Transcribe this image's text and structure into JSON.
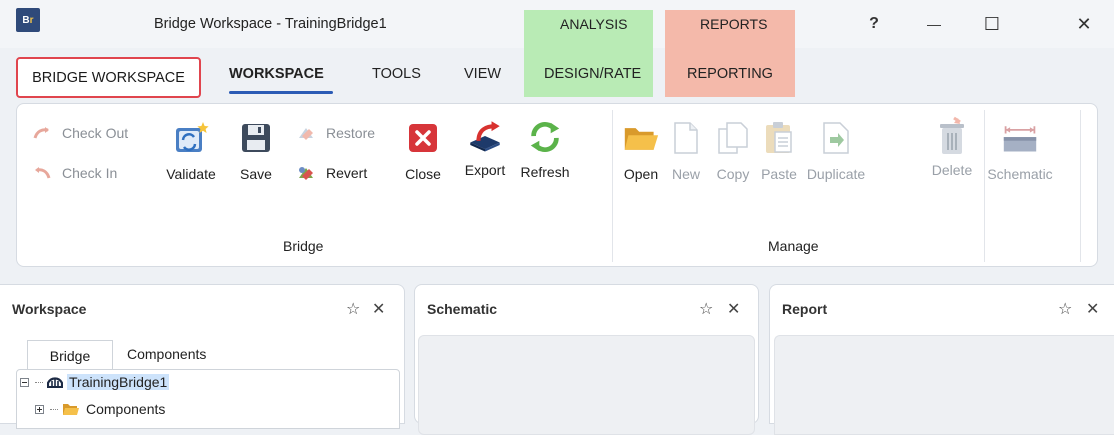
{
  "window": {
    "title": "Bridge Workspace - TrainingBridge1",
    "app_icon": "Br",
    "help": "?",
    "minimize": "—",
    "maximize": "☐",
    "close": "✕"
  },
  "context_tabs": {
    "analysis": {
      "header": "ANALYSIS",
      "tab": "DESIGN/RATE",
      "color": "#b9ebb5"
    },
    "reports": {
      "header": "REPORTS",
      "tab": "REPORTING",
      "color": "#f4b9aa"
    }
  },
  "tabs": {
    "bridge_workspace": "BRIDGE WORKSPACE",
    "workspace": "WORKSPACE",
    "tools": "TOOLS",
    "view": "VIEW"
  },
  "ribbon": {
    "bridge_group": {
      "label": "Bridge",
      "check_out": "Check Out",
      "check_in": "Check In",
      "validate": "Validate",
      "save": "Save",
      "restore": "Restore",
      "revert": "Revert",
      "close": "Close",
      "export": "Export",
      "refresh": "Refresh"
    },
    "manage_group": {
      "label": "Manage",
      "open": "Open",
      "new": "New",
      "copy": "Copy",
      "paste": "Paste",
      "duplicate": "Duplicate",
      "delete": "Delete",
      "schematic": "Schematic"
    }
  },
  "panes": {
    "workspace": {
      "title": "Workspace",
      "tabs": [
        "Bridge",
        "Components"
      ],
      "tree": [
        {
          "label": "TrainingBridge1",
          "icon": "bridge-icon",
          "selected": true
        },
        {
          "label": "Components",
          "icon": "folder-icon"
        }
      ]
    },
    "schematic": {
      "title": "Schematic"
    },
    "report": {
      "title": "Report"
    },
    "pin": "☆",
    "close": "✕"
  },
  "colors": {
    "accent": "#2b5bb5",
    "highlight_border": "#e0454e"
  }
}
